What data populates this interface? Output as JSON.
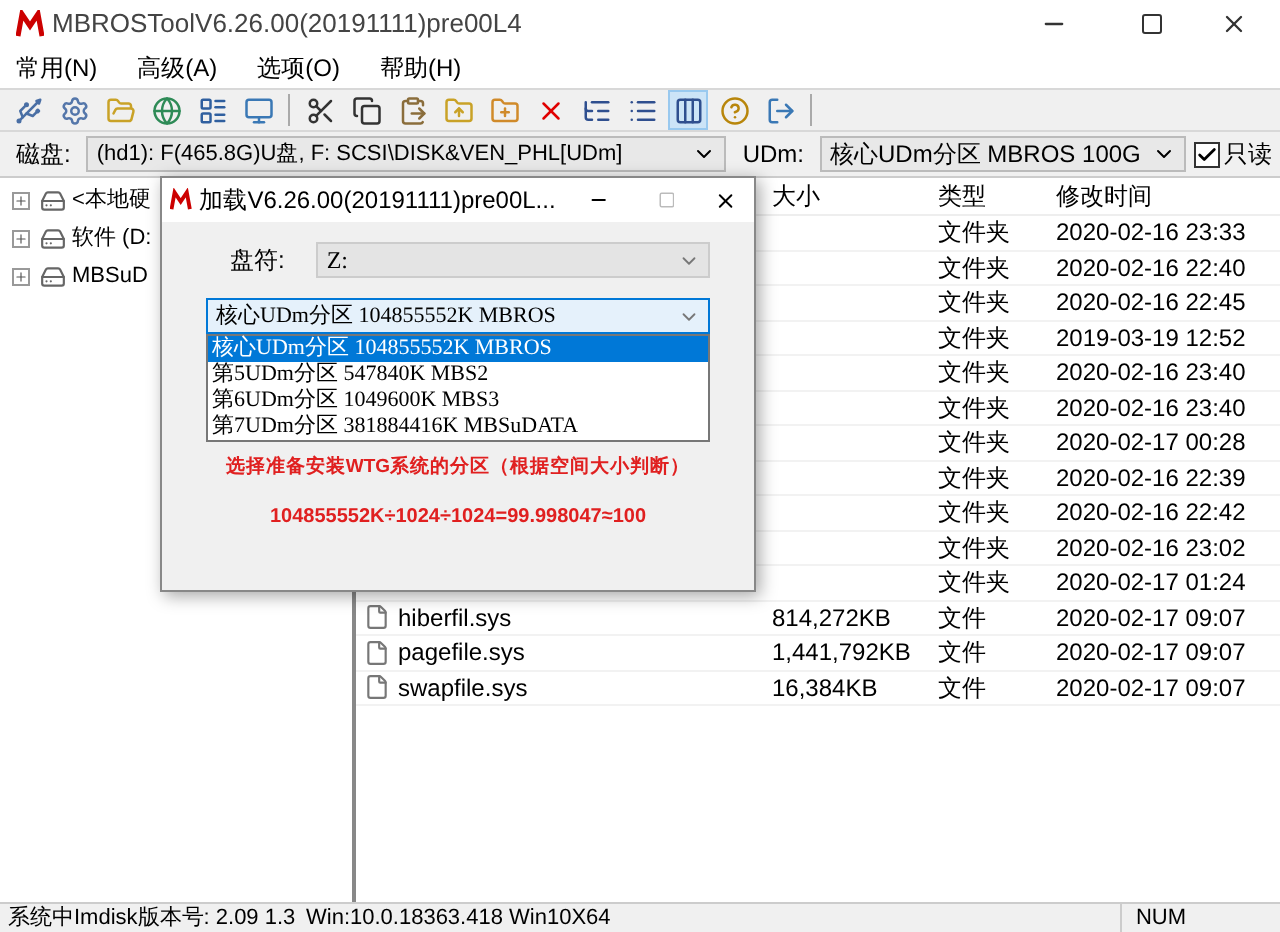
{
  "window": {
    "title": "MBROSToolV6.26.00(20191111)pre00L4"
  },
  "menu": [
    "常用(N)",
    "高级(A)",
    "选项(O)",
    "帮助(H)"
  ],
  "toolbar": [
    {
      "selected": false
    },
    {
      "selected": false
    },
    {
      "selected": false
    },
    {
      "selected": false
    },
    {
      "selected": false
    },
    {
      "selected": false
    },
    {
      "selected": false
    },
    {
      "selected": false
    },
    {
      "selected": false
    },
    {
      "selected": false
    },
    {
      "selected": false
    },
    {
      "selected": false
    },
    {
      "selected": false
    },
    {
      "selected": false
    },
    {
      "selected": true
    },
    {
      "selected": false
    },
    {
      "selected": false
    }
  ],
  "disk_bar": {
    "label": "磁盘:",
    "disk": "(hd1): F(465.8G)U盘, F: SCSI\\DISK&VEN_PHL[UDm]",
    "udm_label": "UDm:",
    "udm": "核心UDm分区 MBROS 100G",
    "readonly": {
      "label": "只读",
      "checked": true
    }
  },
  "tree": [
    {
      "label": "<本地硬"
    },
    {
      "label": "软件 (D:"
    },
    {
      "label": "MBSuD"
    }
  ],
  "file_list": {
    "columns": [
      "大小",
      "类型",
      "修改时间"
    ],
    "rows": [
      {
        "kind": "folder",
        "type": "文件夹",
        "modified": "2020-02-16 23:33"
      },
      {
        "kind": "folder",
        "type": "文件夹",
        "modified": "2020-02-16 22:40"
      },
      {
        "kind": "folder",
        "type": "文件夹",
        "modified": "2020-02-16 22:45"
      },
      {
        "kind": "folder",
        "type": "文件夹",
        "modified": "2019-03-19 12:52"
      },
      {
        "kind": "folder",
        "type": "文件夹",
        "modified": "2020-02-16 23:40"
      },
      {
        "kind": "folder",
        "type": "文件夹",
        "modified": "2020-02-16 23:40"
      },
      {
        "kind": "folder",
        "type": "文件夹",
        "modified": "2020-02-17 00:28"
      },
      {
        "kind": "folder",
        "type": "文件夹",
        "modified": "2020-02-16 22:39"
      },
      {
        "kind": "folder",
        "type": "文件夹",
        "modified": "2020-02-16 22:42"
      },
      {
        "kind": "folder",
        "type": "文件夹",
        "modified": "2020-02-16 23:02"
      },
      {
        "kind": "folder",
        "type": "文件夹",
        "modified": "2020-02-17 01:24"
      },
      {
        "kind": "file",
        "name": "hiberfil.sys",
        "size": "814,272KB",
        "type": "文件",
        "modified": "2020-02-17 09:07"
      },
      {
        "kind": "file",
        "name": "pagefile.sys",
        "size": "1,441,792KB",
        "type": "文件",
        "modified": "2020-02-17 09:07"
      },
      {
        "kind": "file",
        "name": "swapfile.sys",
        "size": "16,384KB",
        "type": "文件",
        "modified": "2020-02-17 09:07"
      }
    ]
  },
  "dialog": {
    "title": "加载V6.26.00(20191111)pre00L...",
    "drive_label": "盘符:",
    "drive": "Z:",
    "partition": "核心UDm分区 104855552K MBROS",
    "options": [
      {
        "label": "核心UDm分区 104855552K MBROS",
        "selected": true
      },
      {
        "label": "第5UDm分区 547840K MBS2",
        "selected": false
      },
      {
        "label": "第6UDm分区 1049600K MBS3",
        "selected": false
      },
      {
        "label": "第7UDm分区 381884416K MBSuDATA",
        "selected": false
      }
    ],
    "hint": "选择准备安装WTG系统的分区（根据空间大小判断）",
    "formula": "104855552K÷1024÷1024=99.998047≈100"
  },
  "status_bar": [
    "系统中Imdisk版本号: 2.09 1.3",
    "Win:10.0.18363.418 Win10X64",
    "NUM"
  ]
}
